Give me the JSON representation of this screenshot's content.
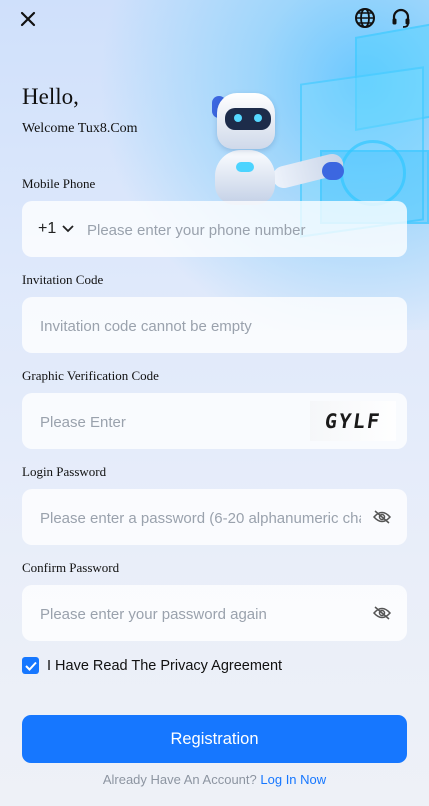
{
  "header": {
    "greeting": "Hello,",
    "welcome": "Welcome Tux8.Com",
    "icons": [
      "close-icon",
      "globe-icon",
      "headset-icon"
    ]
  },
  "form": {
    "mobile": {
      "label": "Mobile Phone",
      "country_code": "+1",
      "placeholder": "Please enter your phone number"
    },
    "invitation": {
      "label": "Invitation Code",
      "placeholder": "Invitation code cannot be empty"
    },
    "captcha": {
      "label": "Graphic Verification Code",
      "placeholder": "Please Enter",
      "image_text": "GYLF"
    },
    "password": {
      "label": "Login Password",
      "placeholder": "Please enter a password (6-20 alphanumeric chara"
    },
    "confirm": {
      "label": "Confirm Password",
      "placeholder": "Please enter your password again"
    },
    "agreement": {
      "checked": true,
      "text": "I Have Read The Privacy Agreement"
    },
    "submit_label": "Registration"
  },
  "footer": {
    "prompt": "Already Have An Account?",
    "link": "Log In Now"
  },
  "colors": {
    "accent": "#1677ff",
    "text": "#111111",
    "placeholder": "#9aa2ad"
  }
}
